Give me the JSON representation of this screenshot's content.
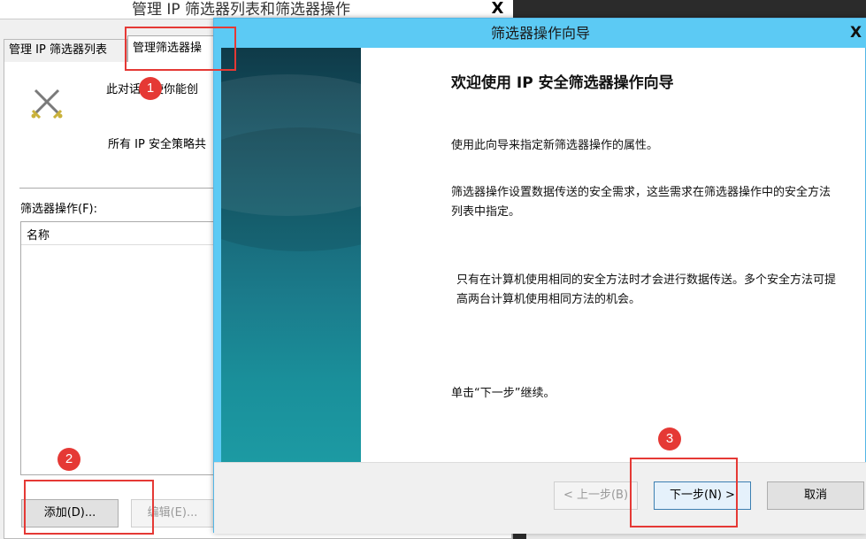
{
  "back_dialog": {
    "title": "管理 IP 筛选器列表和筛选器操作",
    "close_glyph": "X",
    "tabs": [
      {
        "label": "管理 IP 筛选器列表"
      },
      {
        "label": "管理筛选器操"
      }
    ],
    "description_1": "此对话框使你能创",
    "description_2": "所有 IP 安全策略共",
    "filter_actions_label": "筛选器操作(F):",
    "column_name": "名称",
    "add_button": "添加(D)...",
    "edit_button": "编辑(E)..."
  },
  "wizard": {
    "title": "筛选器操作向导",
    "close_glyph": "X",
    "heading": "欢迎使用 IP 安全筛选器操作向导",
    "paragraphs": [
      "使用此向导来指定新筛选器操作的属性。",
      "筛选器操作设置数据传送的安全需求，这些需求在筛选器操作中的安全方法列表中指定。",
      "只有在计算机使用相同的安全方法时才会进行数据传送。多个安全方法可提高两台计算机使用相同方法的机会。",
      "单击“下一步”继续。"
    ],
    "back_button": "< 上一步(B)",
    "next_button": "下一步(N) >",
    "cancel_button": "取消"
  },
  "annotations": {
    "markers": [
      "1",
      "2",
      "3"
    ],
    "color": "#e53935"
  },
  "icons": {
    "dialog_icon": "crossed-swords-icon"
  }
}
